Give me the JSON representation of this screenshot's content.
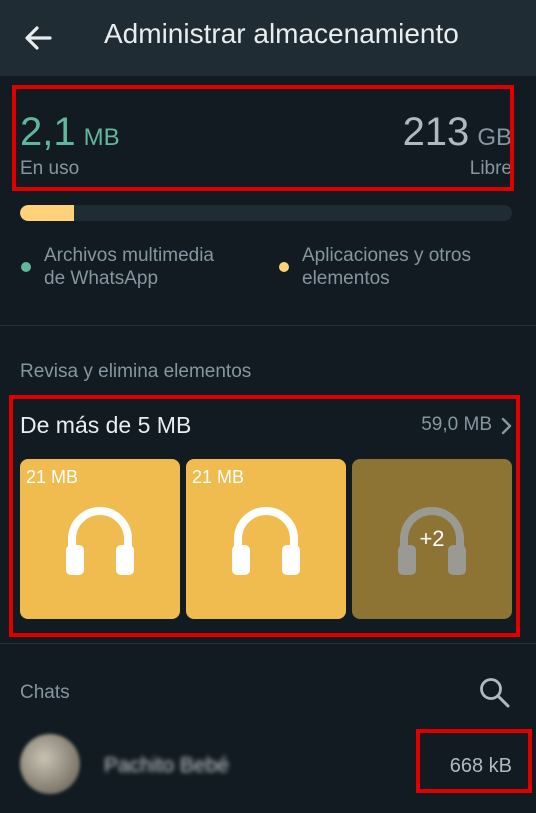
{
  "header": {
    "title": "Administrar almacenamiento",
    "back_icon": "arrow-left-icon"
  },
  "storage": {
    "used_value": "2,1",
    "used_unit": "MB",
    "used_label": "En uso",
    "free_value": "213",
    "free_unit": "GB",
    "free_label": "Libre",
    "bar_fraction": 0.11,
    "colors": {
      "media": "#5fb89b",
      "apps": "#ffd279"
    },
    "legend": [
      {
        "line1": "Archivos multimedia",
        "line2": "de WhatsApp"
      },
      {
        "line1": "Aplicaciones y otros",
        "line2": "elementos"
      }
    ]
  },
  "review": {
    "section_label": "Revisa y elimina elementos",
    "group_title": "De más de 5 MB",
    "group_size": "59,0 MB",
    "chevron_icon": "chevron-right-icon",
    "tiles": [
      {
        "size": "21 MB",
        "icon": "headphones-icon",
        "color": "#f0bc50"
      },
      {
        "size": "21 MB",
        "icon": "headphones-icon",
        "color": "#f0bc50"
      },
      {
        "more": "+2",
        "icon": "headphones-icon",
        "color": "#8e7434"
      }
    ]
  },
  "chats": {
    "section_label": "Chats",
    "search_icon": "search-icon",
    "items": [
      {
        "name": "Pachito Bebé",
        "size": "668 kB"
      }
    ]
  }
}
